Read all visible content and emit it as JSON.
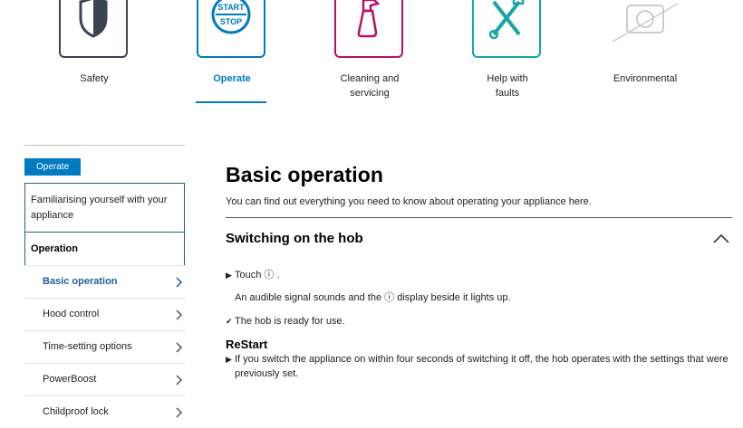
{
  "categories": [
    {
      "label": "Safety",
      "color": "#3a4452",
      "icon": "shield-icon"
    },
    {
      "label": "Operate",
      "color": "#007bc0",
      "icon": "start-stop-icon",
      "icon_text_1": "START",
      "icon_text_2": "STOP"
    },
    {
      "label": "Cleaning and servicing",
      "color": "#b5106b",
      "icon": "spray-bottle-icon"
    },
    {
      "label": "Help with faults",
      "color": "#18a5a7",
      "icon": "wrench-screwdriver-icon"
    },
    {
      "label": "Environmental",
      "color": "#c9ccd1",
      "icon": "camera-crossed-icon"
    }
  ],
  "sidebar": {
    "badge": "Operate",
    "section": "Familiarising yourself with your appliance",
    "heading": "Operation",
    "items": [
      {
        "label": "Basic operation"
      },
      {
        "label": "Hood control"
      },
      {
        "label": "Time-setting options"
      },
      {
        "label": "PowerBoost"
      },
      {
        "label": "Childproof lock"
      }
    ]
  },
  "main": {
    "title": "Basic operation",
    "intro": "You can find out everything you need to know about operating your appliance here.",
    "section_title": "Switching on the hob",
    "step1_a": "Touch",
    "step1_b": ".",
    "power_symbol": "ⓘ",
    "step2_a": "An audible signal sounds and the",
    "step2_b": "display beside it lights up.",
    "step3": "The hob is ready for use.",
    "restart_title": "ReStart",
    "restart_text": "If you switch the appliance on within four seconds of switching it off, the hob operates with the settings that were previously set."
  }
}
